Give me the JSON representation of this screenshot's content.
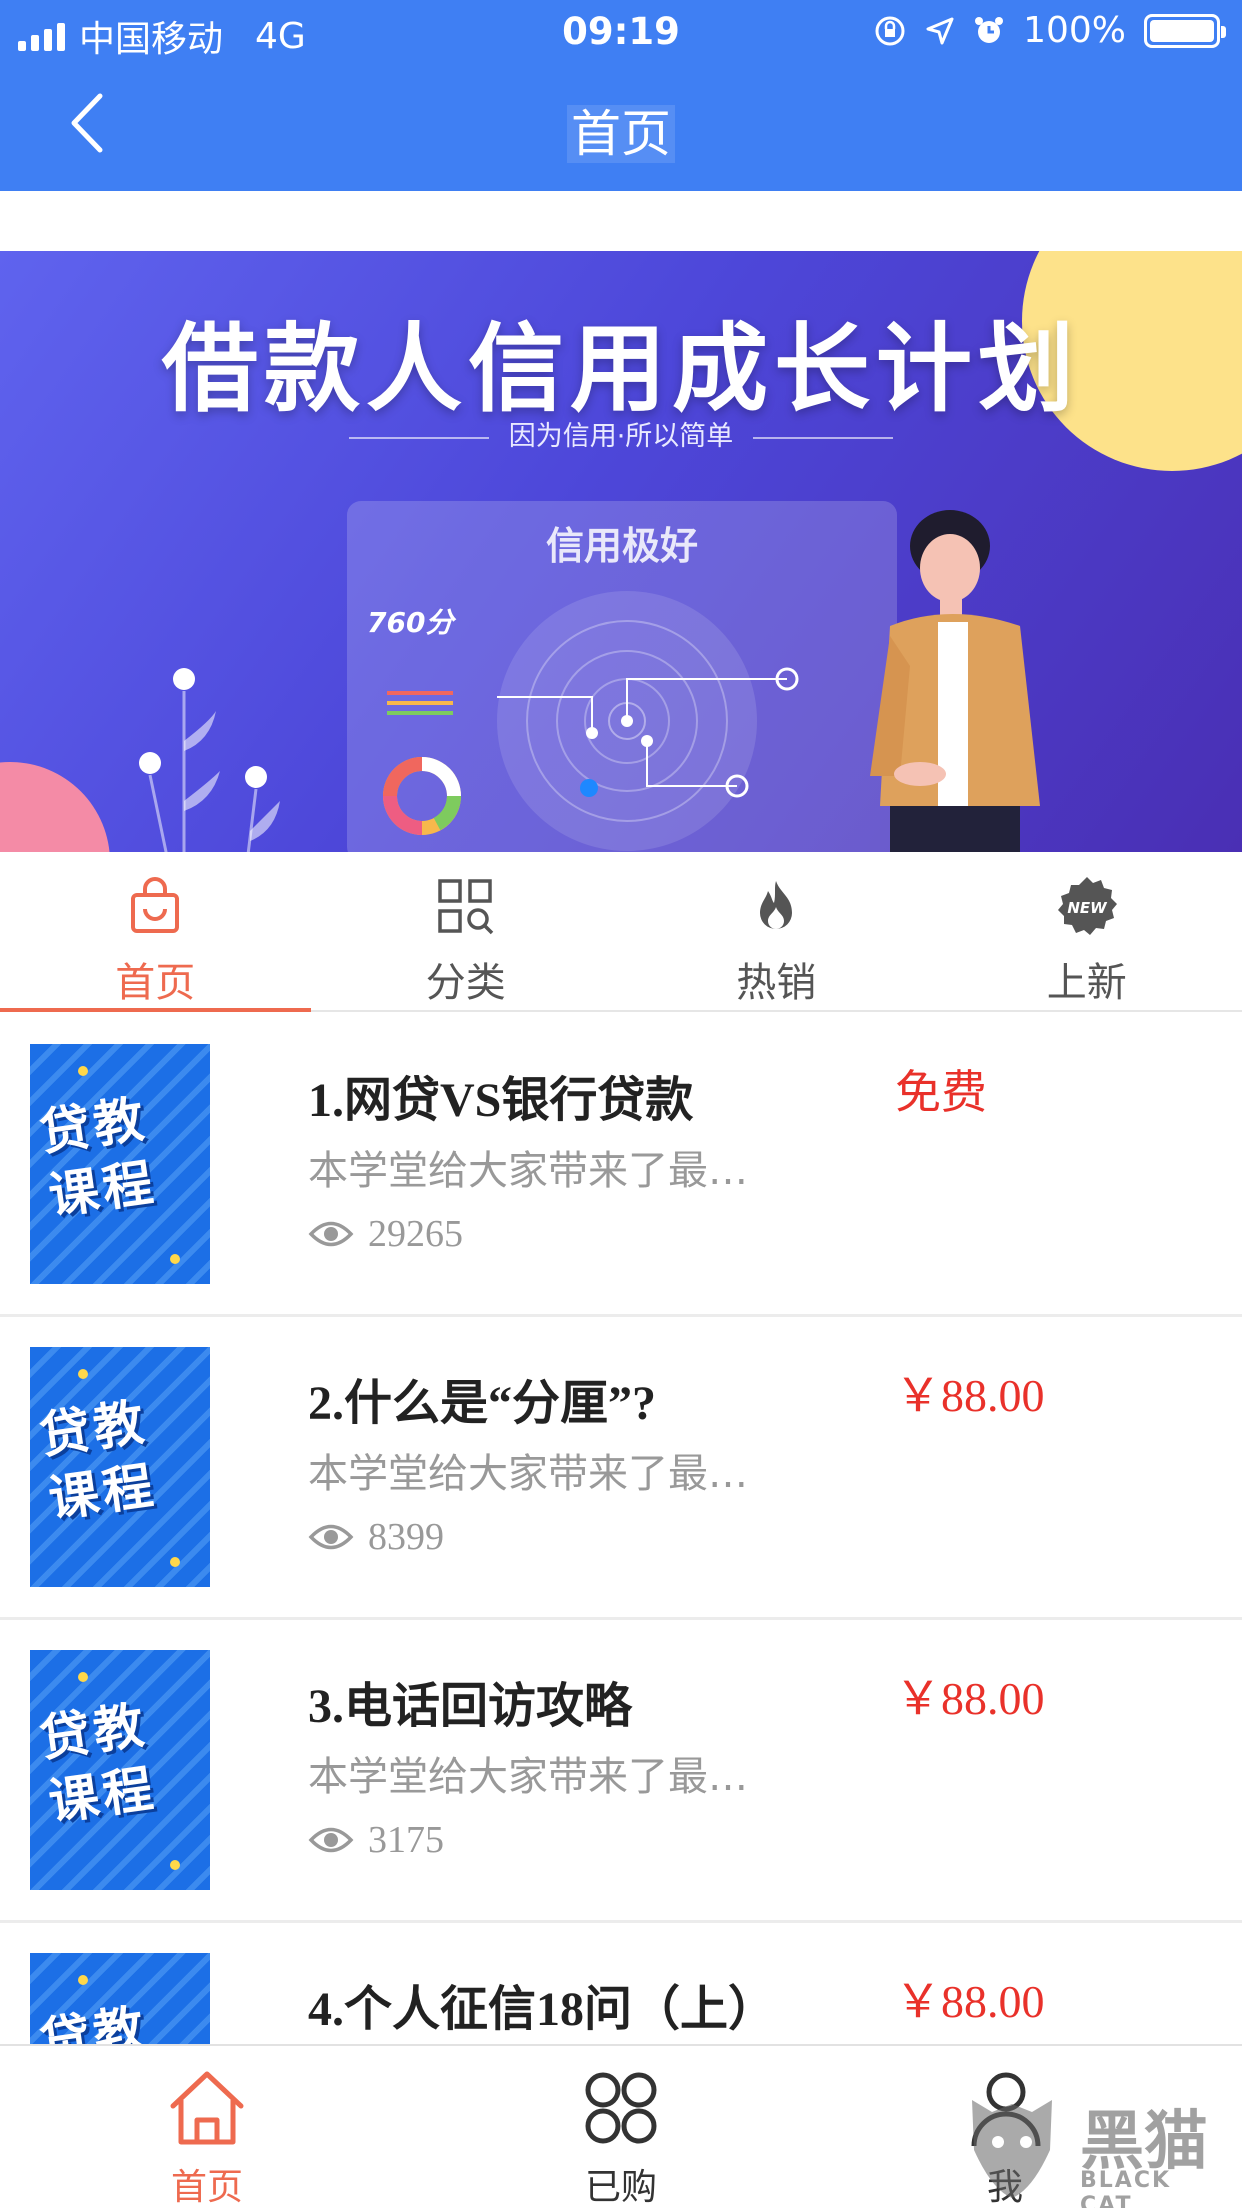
{
  "status_bar": {
    "carrier": "中国移动",
    "network": "4G",
    "time": "09:19",
    "battery": "100%"
  },
  "nav": {
    "title": "首页",
    "back_icon": "chevron-left-icon"
  },
  "banner": {
    "title": "借款人信用成长计划",
    "subtitle": "因为信用·所以简单",
    "panel_title": "信用极好",
    "score": "760分"
  },
  "category_tabs": [
    {
      "label": "首页",
      "icon": "shopping-bag-icon",
      "active": true
    },
    {
      "label": "分类",
      "icon": "grid-search-icon",
      "active": false
    },
    {
      "label": "热销",
      "icon": "flame-icon",
      "active": false
    },
    {
      "label": "上新",
      "icon": "new-badge-icon",
      "active": false
    }
  ],
  "course_thumb_text": "贷教课程",
  "courses": [
    {
      "title": "1.网贷VS银行贷款",
      "desc": "本学堂给大家带来了最…",
      "views": "29265",
      "price": "免费"
    },
    {
      "title": "2.什么是“分厘”?",
      "desc": "本学堂给大家带来了最…",
      "views": "8399",
      "price": "￥88.00"
    },
    {
      "title": "3.电话回访攻略",
      "desc": "本学堂给大家带来了最…",
      "views": "3175",
      "price": "￥88.00"
    },
    {
      "title": "4.个人征信18问（上）",
      "desc": "",
      "views": "",
      "price": "￥88.00"
    }
  ],
  "bottom_tabs": [
    {
      "label": "首页",
      "icon": "home-icon",
      "active": true
    },
    {
      "label": "已购",
      "icon": "four-circles-icon",
      "active": false
    },
    {
      "label": "我",
      "icon": "user-icon",
      "active": false
    }
  ],
  "watermark": {
    "text": "黑猫",
    "sub": "BLACK CAT"
  },
  "colors": {
    "nav_blue": "#3f7ff3",
    "accent_orange": "#ee6a4f",
    "price_red": "#e9312a",
    "thumb_blue": "#1c6fe6"
  }
}
